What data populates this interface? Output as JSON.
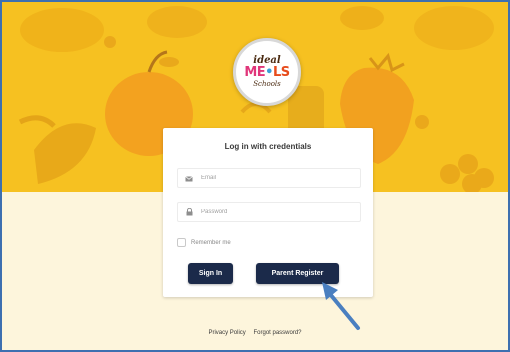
{
  "brand": {
    "logo_top": "ideal",
    "logo_m1": "ME",
    "logo_dot": "•",
    "logo_m2": "LS",
    "logo_bottom": "Schools"
  },
  "login": {
    "title": "Log in with credentials",
    "email_placeholder": "Email",
    "password_placeholder": "Password",
    "remember_label": "Remember me",
    "signin_label": "Sign In",
    "register_label": "Parent Register"
  },
  "footer": {
    "privacy": "Privacy Policy",
    "forgot": "Forgot password?"
  },
  "colors": {
    "banner": "#f6c121",
    "background": "#fdf5dc",
    "button": "#1b2a4a",
    "arrow": "#4a7fc0"
  },
  "icons": {
    "email": "envelope-icon",
    "password": "lock-icon",
    "annotation": "arrow-icon"
  }
}
